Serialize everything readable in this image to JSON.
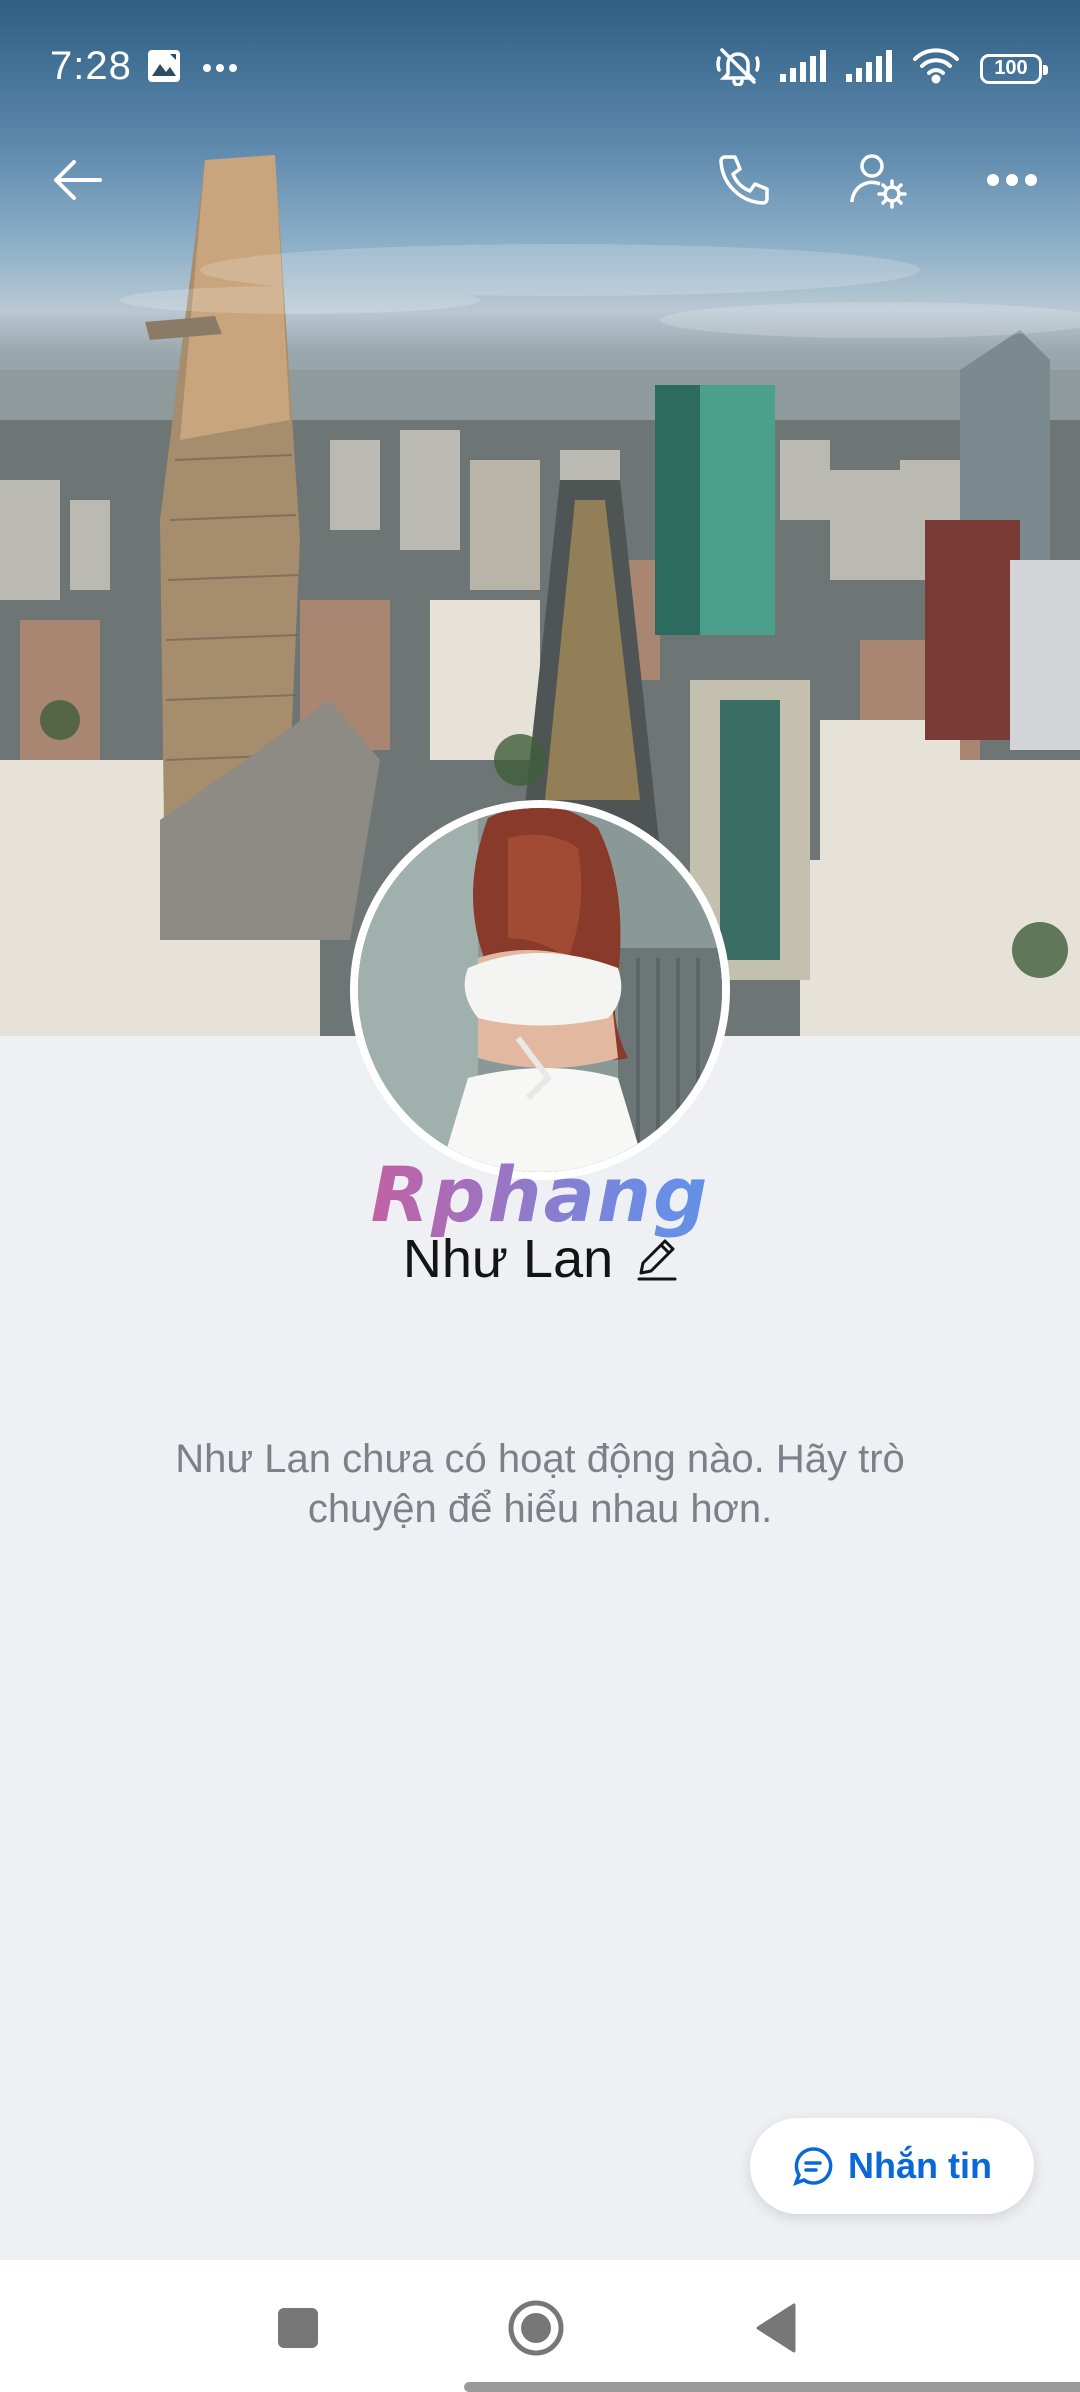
{
  "status_bar": {
    "time": "7:28",
    "battery": "100",
    "left_icons": [
      "gallery-icon",
      "more-dots-icon"
    ],
    "right_icons": [
      "mute-icon",
      "signal-icon",
      "signal-icon",
      "wifi-icon",
      "battery-icon"
    ]
  },
  "top_bar": {
    "icons": [
      "back-arrow-icon",
      "phone-icon",
      "user-settings-icon",
      "more-horizontal-icon"
    ]
  },
  "profile": {
    "watermark": "Rphang",
    "name": "Như Lan",
    "empty_state": "Như Lan chưa có hoạt động nào. Hãy trò chuyện để hiểu nhau hơn."
  },
  "message_button": {
    "label": "Nhắn tin",
    "icon": "chat-bubble-icon"
  },
  "nav_bar": {
    "icons": [
      "recents-square-icon",
      "home-circle-icon",
      "back-triangle-icon"
    ]
  },
  "colors": {
    "background": "#eff0f4",
    "accent": "#0a68d8",
    "name_text": "#141414",
    "secondary_text": "#7c8089"
  }
}
